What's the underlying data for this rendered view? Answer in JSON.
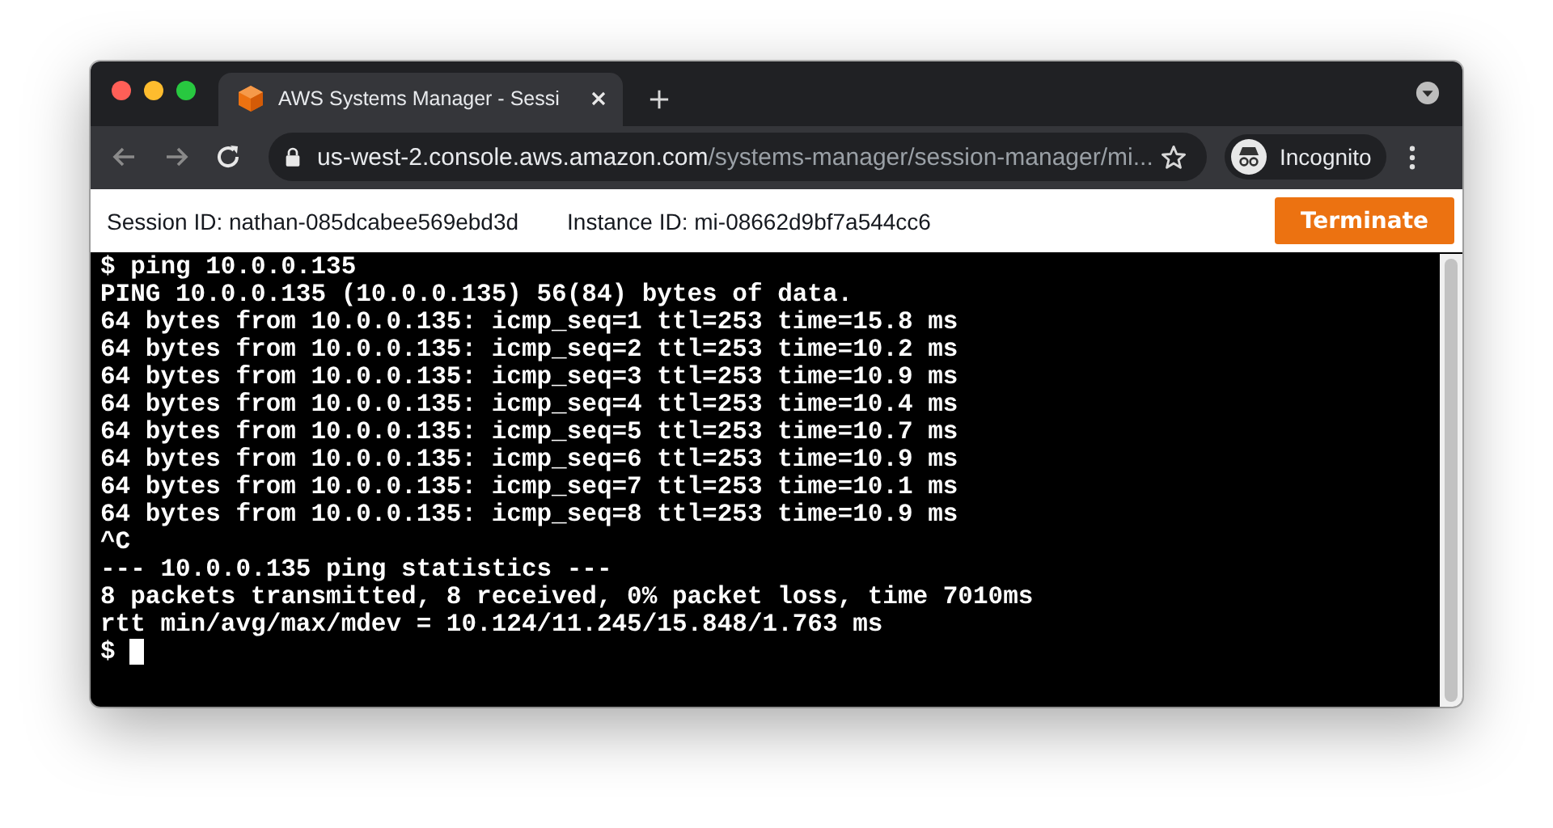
{
  "browser": {
    "tabs": [
      {
        "title": "AWS Systems Manager - Sessi",
        "selected": true
      }
    ],
    "url": {
      "host": "us-west-2.console.aws.amazon.com",
      "path": "/systems-manager/session-manager/mi..."
    },
    "profile": "Incognito"
  },
  "session_bar": {
    "session_id": "Session ID: nathan-085dcabee569ebd3d",
    "instance_id": "Instance ID: mi-08662d9bf7a544cc6",
    "button": "Terminate"
  },
  "terminal": {
    "lines": [
      "$ ping 10.0.0.135",
      "PING 10.0.0.135 (10.0.0.135) 56(84) bytes of data.",
      "64 bytes from 10.0.0.135: icmp_seq=1 ttl=253 time=15.8 ms",
      "64 bytes from 10.0.0.135: icmp_seq=2 ttl=253 time=10.2 ms",
      "64 bytes from 10.0.0.135: icmp_seq=3 ttl=253 time=10.9 ms",
      "64 bytes from 10.0.0.135: icmp_seq=4 ttl=253 time=10.4 ms",
      "64 bytes from 10.0.0.135: icmp_seq=5 ttl=253 time=10.7 ms",
      "64 bytes from 10.0.0.135: icmp_seq=6 ttl=253 time=10.9 ms",
      "64 bytes from 10.0.0.135: icmp_seq=7 ttl=253 time=10.1 ms",
      "64 bytes from 10.0.0.135: icmp_seq=8 ttl=253 time=10.9 ms",
      "^C",
      "--- 10.0.0.135 ping statistics ---",
      "8 packets transmitted, 8 received, 0% packet loss, time 7010ms",
      "rtt min/avg/max/mdev = 10.124/11.245/15.848/1.763 ms"
    ],
    "prompt": "$"
  }
}
